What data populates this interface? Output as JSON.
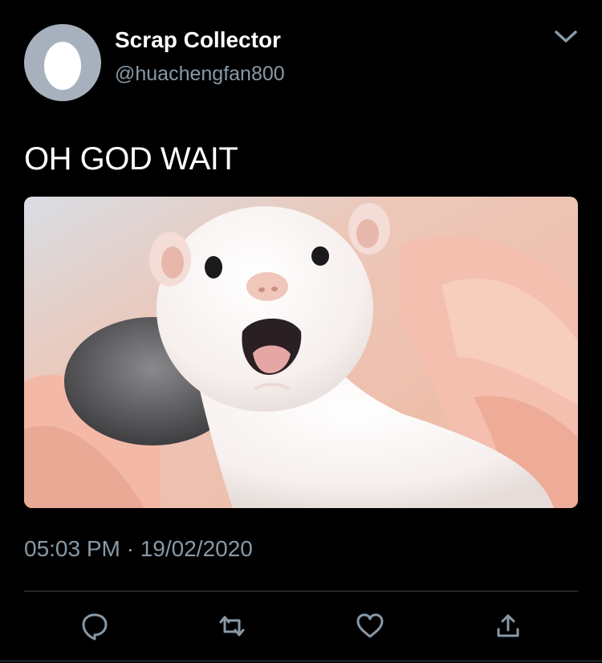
{
  "author": {
    "display_name": "Scrap Collector",
    "handle": "@huachengfan800",
    "avatar_icon": "default-egg-avatar-icon",
    "avatar_bg": "#a7b1bd"
  },
  "header": {
    "menu_icon": "chevron-down-icon"
  },
  "tweet": {
    "text": "OH GOD WAIT",
    "media_description_icon": "photo",
    "timestamp": "05:03 PM · 19/02/2020"
  },
  "actions": [
    {
      "icon": "reply-icon"
    },
    {
      "icon": "retweet-icon"
    },
    {
      "icon": "like-icon"
    },
    {
      "icon": "share-icon"
    }
  ],
  "colors": {
    "background": "#000000",
    "primary_text": "#ffffff",
    "secondary_text": "#8899a6",
    "divider": "#38444d"
  }
}
